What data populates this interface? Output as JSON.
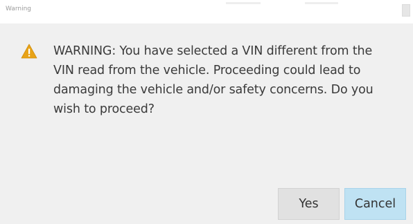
{
  "window": {
    "title": "Warning"
  },
  "message": {
    "lines": [
      "WARNING:  You have selected a VIN different from the",
      "VIN read from the vehicle.  Proceeding could lead to",
      "damaging the vehicle and/or safety concerns.  Do you",
      "wish to proceed?"
    ]
  },
  "buttons": {
    "yes_label": "Yes",
    "cancel_label": "Cancel"
  },
  "icons": {
    "warning": "warning-triangle-icon"
  },
  "colors": {
    "warning_icon": "#e8a317",
    "cancel_button": "#bfe2f3",
    "yes_button": "#e1e1e1"
  }
}
